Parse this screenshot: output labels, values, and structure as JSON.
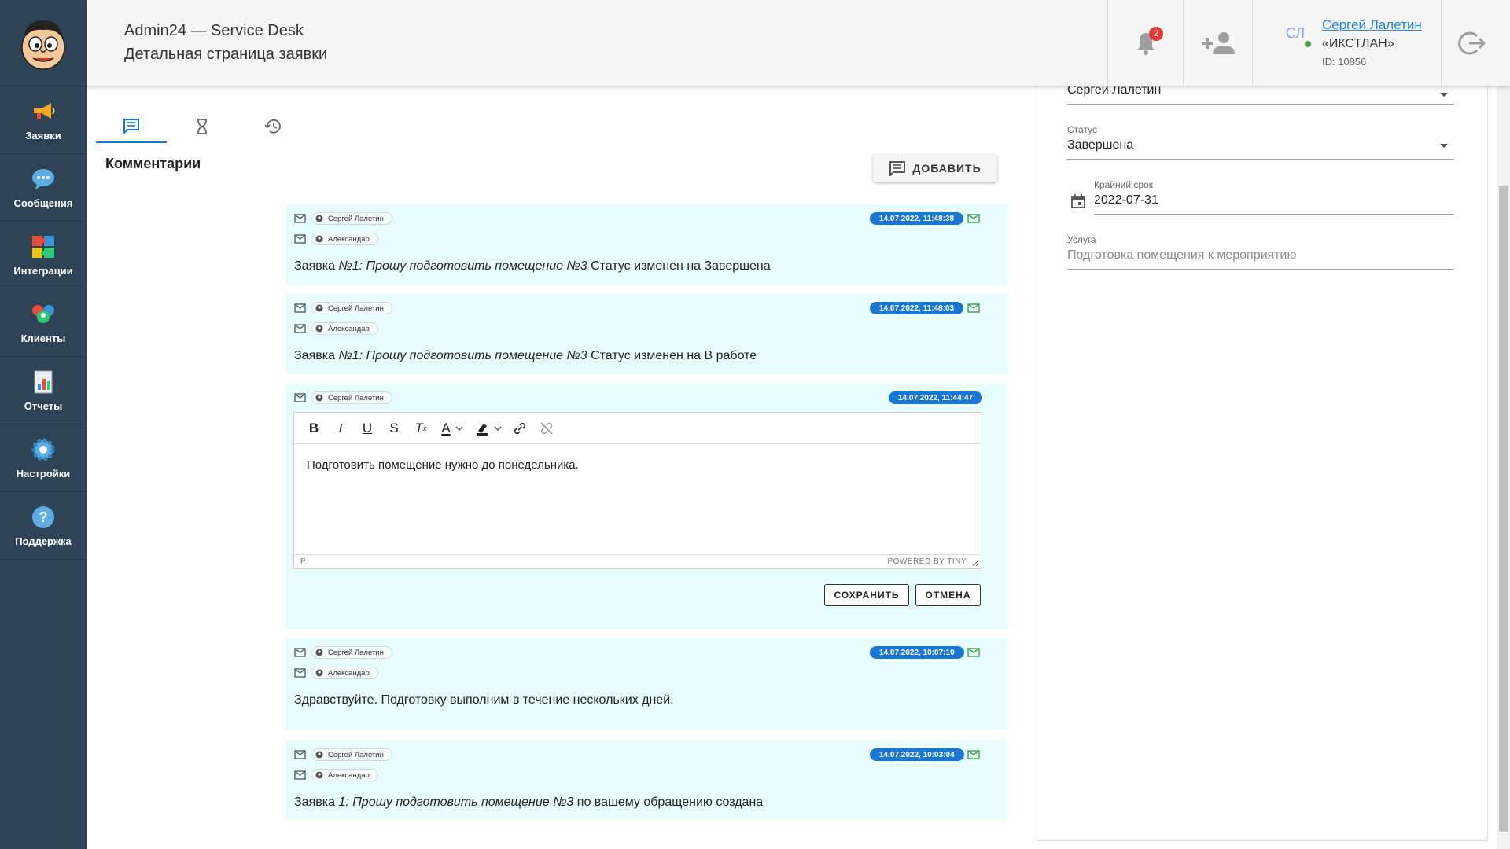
{
  "sidebar": {
    "items": [
      {
        "label": "Заявки",
        "icon": "megaphone-icon"
      },
      {
        "label": "Сообщения",
        "icon": "chat-icon"
      },
      {
        "label": "Интеграции",
        "icon": "puzzle-icon"
      },
      {
        "label": "Клиенты",
        "icon": "users-icon"
      },
      {
        "label": "Отчеты",
        "icon": "report-icon"
      },
      {
        "label": "Настройки",
        "icon": "gear-icon"
      },
      {
        "label": "Поддержка",
        "icon": "help-icon"
      }
    ]
  },
  "header": {
    "title": "Admin24 — Service Desk",
    "subtitle": "Детальная страница заявки",
    "notifications_count": "2",
    "user": {
      "initials": "СЛ",
      "name": "Сергей Лалетин",
      "org": "«ИКСТЛАН»",
      "id": "ID: 10856"
    }
  },
  "tabs": [
    {
      "icon": "comments-icon",
      "active": true
    },
    {
      "icon": "hourglass-icon",
      "active": false
    },
    {
      "icon": "history-icon",
      "active": false
    }
  ],
  "comments_section": {
    "title": "Комментарии",
    "add_label": "ДОБАВИТЬ"
  },
  "comments": [
    {
      "from": "Сергей Лалетин",
      "to": "Александар",
      "time": "14.07.2022, 11:48:38",
      "text_prefix": "Заявка ",
      "text_italic": "№1: Прошу подготовить помещение №3",
      "text_suffix": " Статус изменен на Завершена"
    },
    {
      "from": "Сергей Лалетин",
      "to": "Александар",
      "time": "14.07.2022, 11:48:03",
      "text_prefix": "Заявка ",
      "text_italic": "№1: Прошу подготовить помещение №3",
      "text_suffix": " Статус изменен на В работе"
    },
    {
      "from": "Сергей Лалетин",
      "time": "14.07.2022, 11:44:47",
      "editor_text": "Подготовить помещение нужно до понедельника.",
      "editor_path": "P",
      "editor_powered": "POWERED BY TINY",
      "save_label": "СОХРАНИТЬ",
      "cancel_label": "ОТМЕНА"
    },
    {
      "from": "Сергей Лалетин",
      "to": "Александар",
      "time": "14.07.2022, 10:07:10",
      "text": "Здравствуйте. Подготовку выполним в течение нескольких дней."
    },
    {
      "from": "Сергей Лалетин",
      "to": "Александар",
      "time": "14.07.2022, 10:03:04",
      "text_prefix": "Заявка ",
      "text_italic": "1: Прошу подготовить помещение №3",
      "text_suffix": " по вашему обращению создана"
    }
  ],
  "details": {
    "assignee_value": "Сергей Лалетин",
    "status_label": "Статус",
    "status_value": "Завершена",
    "deadline_label": "Крайний срок",
    "deadline_value": "2022-07-31",
    "service_label": "Услуга",
    "service_value": "Подготовка помещения к мероприятию"
  },
  "colors": {
    "sidebar_bg": "#2f4357",
    "comment_bg": "#e6fcfe",
    "accent": "#1976d2",
    "badge": "#e53935",
    "link": "#1e88e5",
    "sent_icon": "#43a047"
  }
}
